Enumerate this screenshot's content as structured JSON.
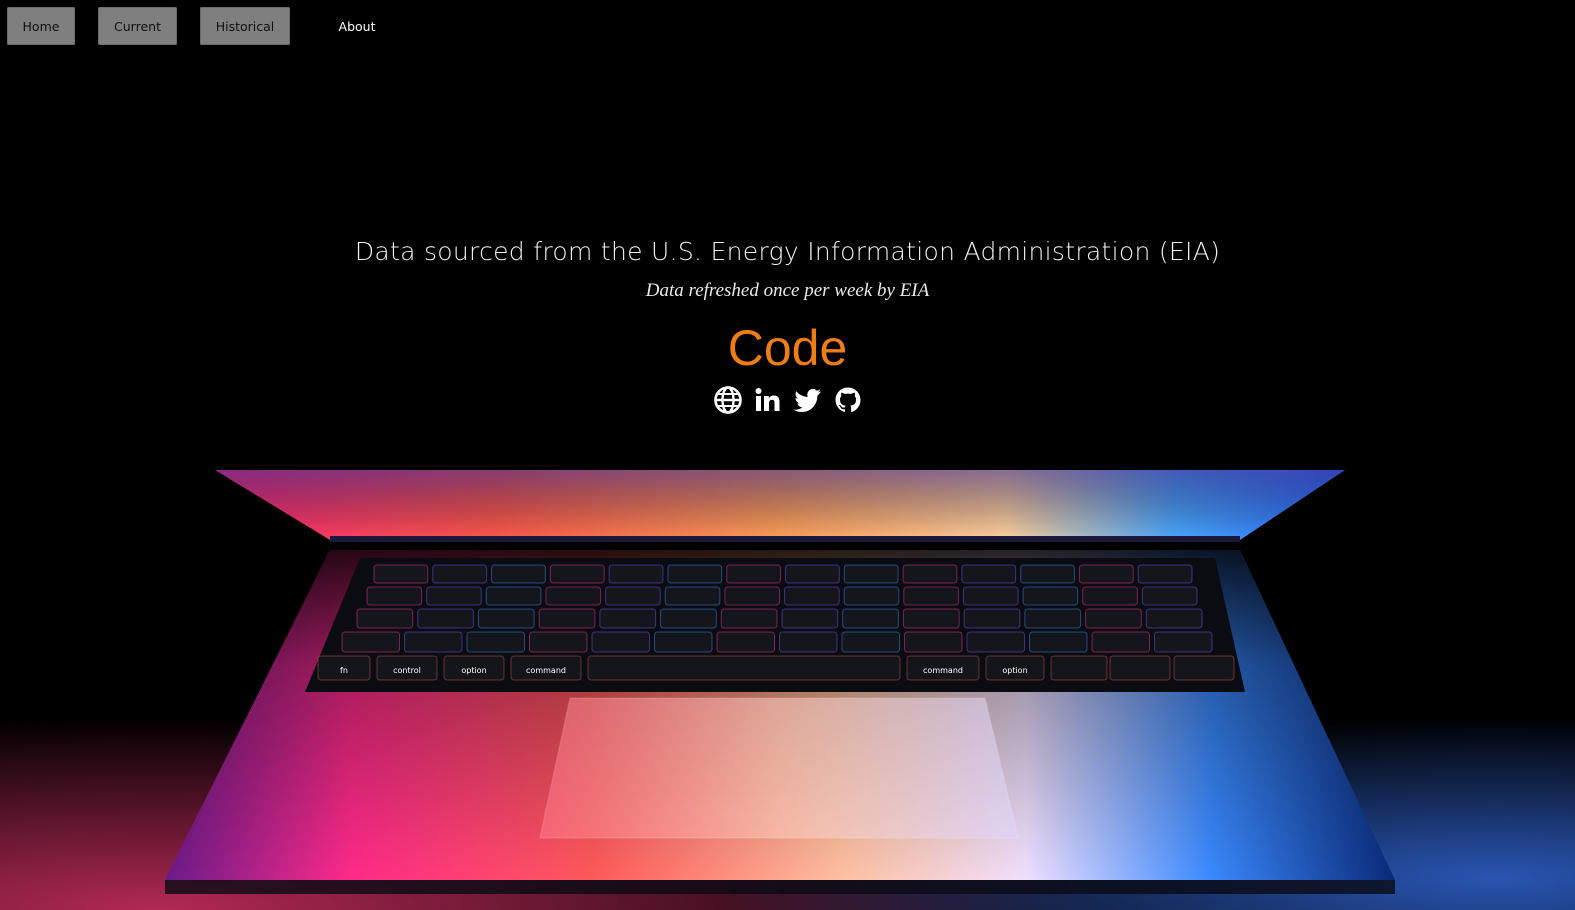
{
  "nav": {
    "home_label": "Home",
    "current_label": "Current",
    "historical_label": "Historical",
    "about_label": "About"
  },
  "hero": {
    "title": "Data sourced from the U.S. Energy Information Administration (EIA)",
    "subtitle": "Data refreshed once per week by EIA",
    "code_link": "Code"
  },
  "social_icons": [
    "globe-icon",
    "linkedin-icon",
    "twitter-icon",
    "github-icon"
  ],
  "colors": {
    "background": "#000000",
    "nav_button": "#7f7f7f",
    "code_accent": "#ee7d16",
    "text": "#ffffff"
  },
  "keyboard_labels": {
    "control": "control",
    "option": "option",
    "command": "command",
    "fn": "fn"
  }
}
